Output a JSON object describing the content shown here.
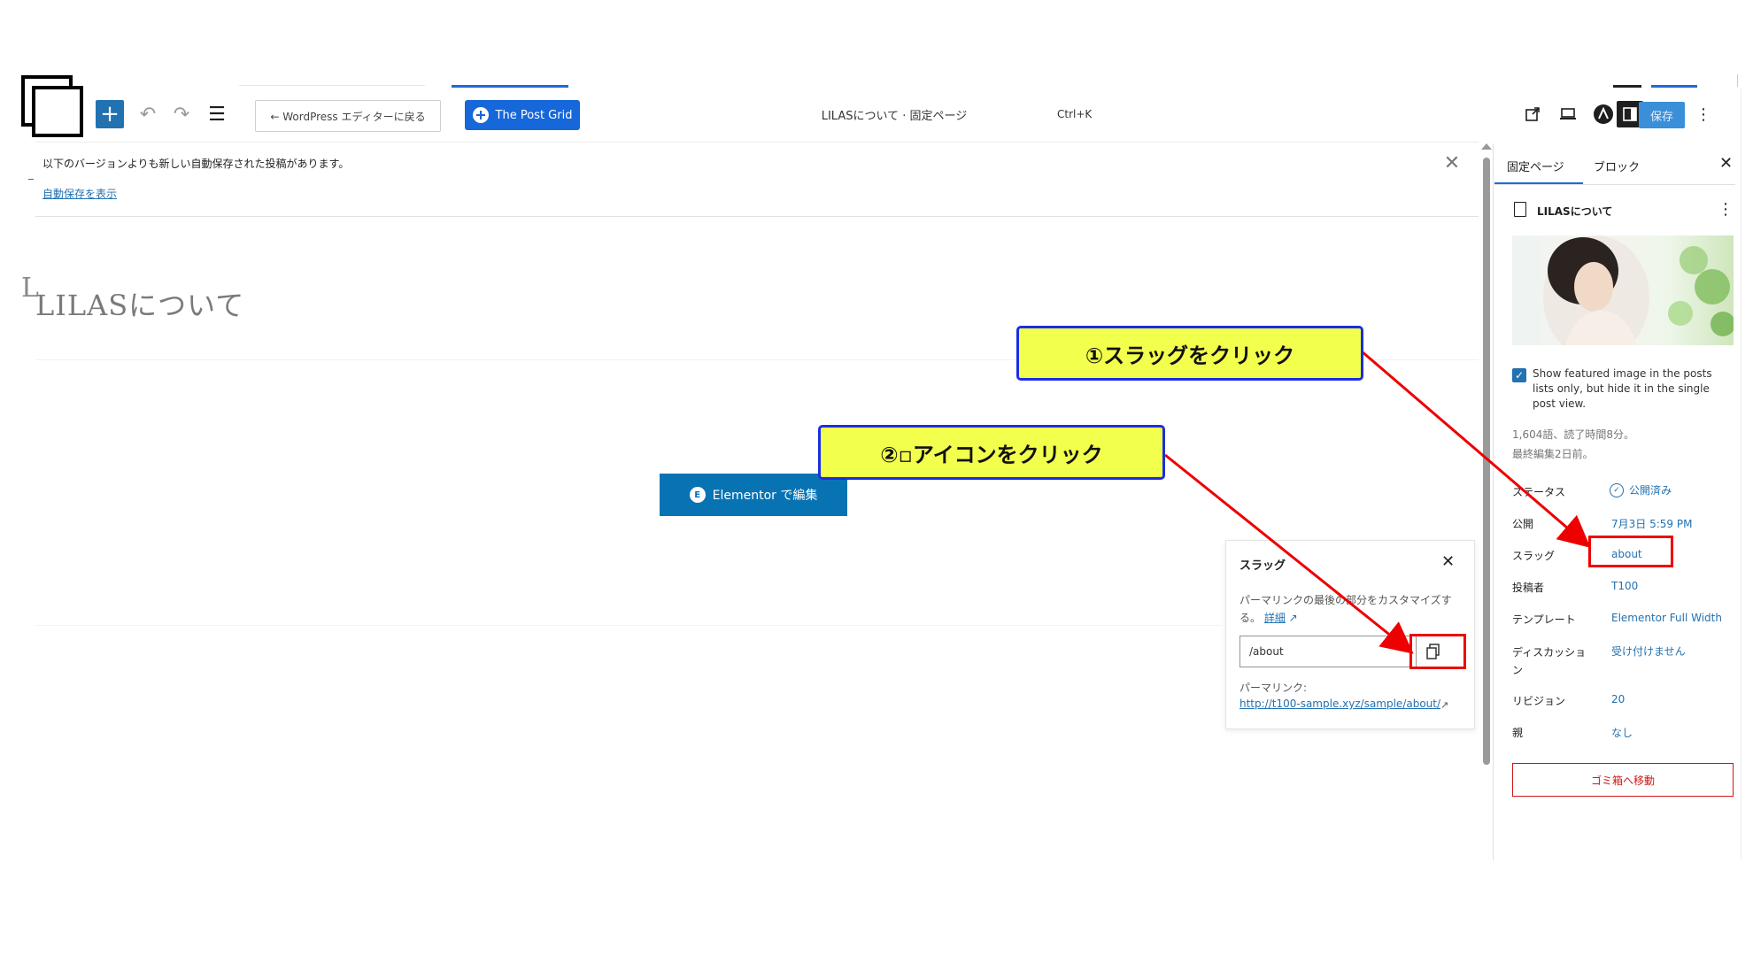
{
  "toolbar": {
    "add_label": "+",
    "undo_icon": "↶",
    "redo_icon": "↷",
    "outline_icon": "☰",
    "back_label": "← WordPress エディターに戻る",
    "postgrid_label": "The Post Grid",
    "document_title": "LILASについて · 固定ページ",
    "shortcut": "Ctrl+K",
    "save_label": "保存"
  },
  "notice": {
    "text": "以下のバージョンよりも新しい自動保存された投稿があります。",
    "link": "自動保存を表示"
  },
  "editor": {
    "title_first_letter": "L",
    "title": "LILASについて",
    "elementor_button": "Elementor で編集"
  },
  "slug_popover": {
    "title": "スラッグ",
    "desc": "パーマリンクの最後の部分をカスタマイズする。",
    "detail_link": "詳細",
    "input_value": "/about",
    "permalink_label": "パーマリンク:",
    "permalink_url": "http://t100-sample.xyz/sample/about/"
  },
  "sidebar": {
    "tabs": [
      "固定ページ",
      "ブロック"
    ],
    "card_title": "LILASについて",
    "checkbox_label": "Show featured image in the posts lists only, but hide it in the single post view.",
    "word_count": "1,604語、読了時間8分。",
    "last_edit": "最終編集2日前。",
    "meta": [
      {
        "label": "ステータス",
        "value": "公開済み"
      },
      {
        "label": "公開",
        "value": "7月3日 5:59 PM"
      },
      {
        "label": "スラッグ",
        "value": "about"
      },
      {
        "label": "投稿者",
        "value": "T100"
      },
      {
        "label": "テンプレート",
        "value": "Elementor Full Width"
      },
      {
        "label": "ディスカッション",
        "value": "受け付けません"
      },
      {
        "label": "リビジョン",
        "value": "20"
      },
      {
        "label": "親",
        "value": "なし"
      }
    ],
    "trash_label": "ゴミ箱へ移動"
  },
  "annotations": {
    "callout1": "①スラッグをクリック",
    "callout2": "②▫アイコンをクリック"
  },
  "colors": {
    "accent": "#2271b1",
    "callout_bg": "#f2ff4c",
    "callout_border": "#1a2fe0",
    "annotation_red": "#ee0000"
  }
}
